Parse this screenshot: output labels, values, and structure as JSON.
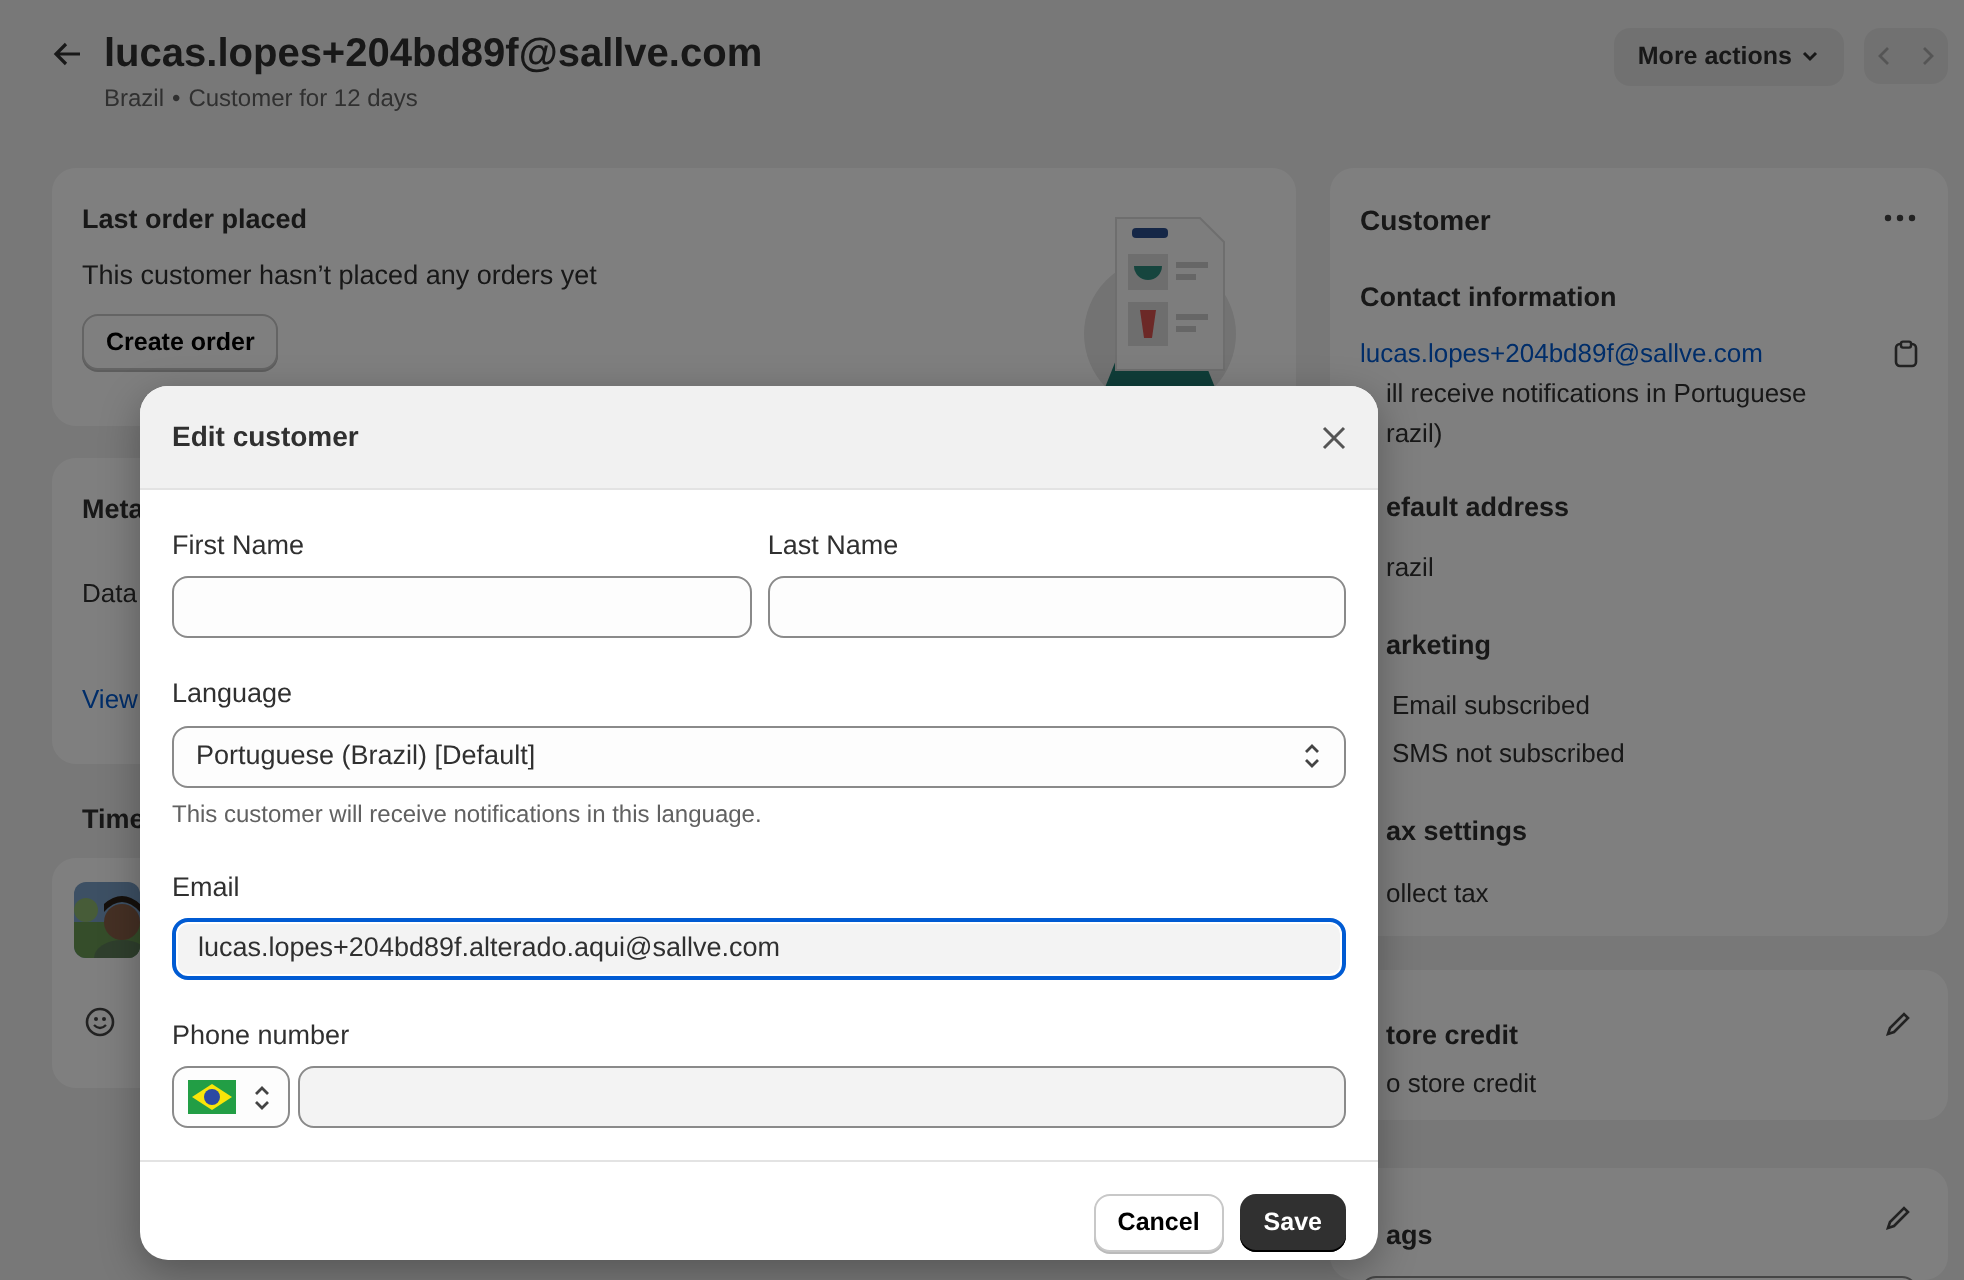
{
  "header": {
    "title": "lucas.lopes+204bd89f@sallve.com",
    "country": "Brazil",
    "separator": "•",
    "since": "Customer for 12 days",
    "more_actions": "More actions"
  },
  "last_order": {
    "title": "Last order placed",
    "text": "This customer hasn’t placed any orders yet",
    "button": "Create order"
  },
  "metafields": {
    "title": "Meta",
    "row": "Data",
    "link": "View"
  },
  "timeline": {
    "title": "Time"
  },
  "customer": {
    "title": "Customer",
    "contact_heading": "Contact information",
    "email": "lucas.lopes+204bd89f@sallve.com",
    "notice_lines": [
      "ill receive notifications in Portuguese",
      "razil)"
    ],
    "sections": [
      {
        "heading": "efault address",
        "lines": [
          "razil"
        ],
        "kind": "plain"
      },
      {
        "heading": "arketing",
        "lines": [
          "Email subscribed",
          "SMS not subscribed"
        ],
        "kind": "indented"
      },
      {
        "heading": "ax settings",
        "lines": [
          "ollect tax"
        ],
        "kind": "plain"
      }
    ]
  },
  "store_credit": {
    "title": "tore credit",
    "text": "o store credit"
  },
  "tags": {
    "title": "ags"
  },
  "modal": {
    "title": "Edit customer",
    "name_fields": [
      {
        "label": "First Name"
      },
      {
        "label": "Last Name"
      }
    ],
    "language": {
      "label": "Language",
      "value": "Portuguese (Brazil) [Default]",
      "help": "This customer will receive notifications in this language."
    },
    "email": {
      "label": "Email",
      "value": "lucas.lopes+204bd89f.alterado.aqui@sallve.com",
      "focused": true
    },
    "phone": {
      "label": "Phone number"
    },
    "buttons": [
      {
        "label": "Cancel",
        "kind": "secondary"
      },
      {
        "label": "Save",
        "kind": "primary"
      }
    ]
  }
}
